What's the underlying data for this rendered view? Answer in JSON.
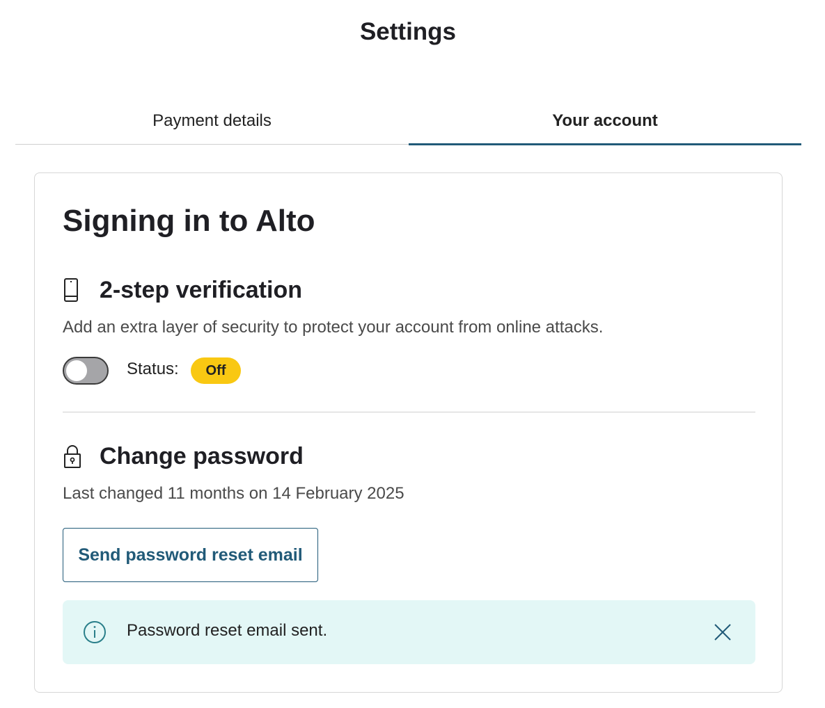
{
  "page": {
    "title": "Settings"
  },
  "tabs": [
    {
      "label": "Payment details",
      "active": false
    },
    {
      "label": "Your account",
      "active": true
    }
  ],
  "card": {
    "title": "Signing in to Alto",
    "two_step": {
      "icon": "phone-icon",
      "heading": "2-step verification",
      "description": "Add an extra layer of security to protect your account from online attacks.",
      "toggle_on": false,
      "status_label": "Status:",
      "status_value": "Off"
    },
    "password": {
      "icon": "lock-icon",
      "heading": "Change password",
      "last_changed": "Last changed 11 months on 14 February 2025",
      "reset_button": "Send password reset email"
    },
    "alert": {
      "icon": "info-icon",
      "message": "Password reset email sent.",
      "close_icon": "close-icon"
    }
  },
  "colors": {
    "accent": "#215a78",
    "badge_off": "#f9c812",
    "alert_bg": "#e3f7f6",
    "info_icon": "#2a7f8a"
  }
}
